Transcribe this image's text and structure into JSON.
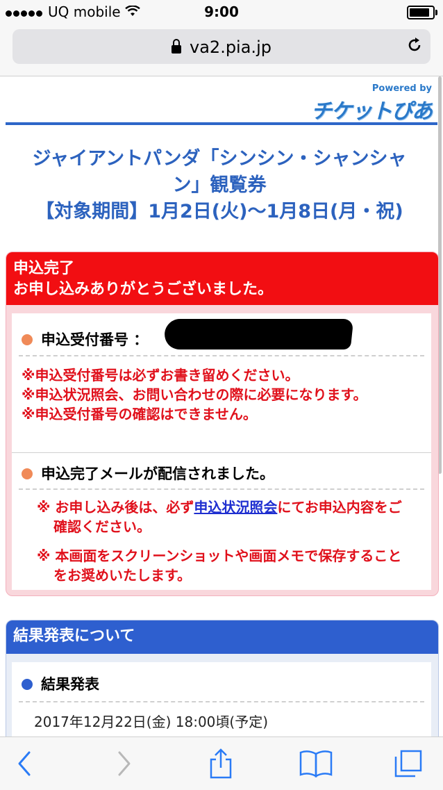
{
  "status_bar": {
    "carrier": "UQ mobile",
    "time": "9:00"
  },
  "browser": {
    "url": "va2.pia.jp"
  },
  "logo": {
    "powered_by": "Powered by",
    "brand": "チケットぴあ"
  },
  "event": {
    "title_line1": "ジャイアントパンダ「シンシン・シャンシャ",
    "title_line2": "ン」観覧券",
    "period": "【対象期間】1月2日(火)〜1月8日(月・祝)"
  },
  "complete": {
    "heading_line1": "申込完了",
    "heading_line2": "お申し込みありがとうございました。",
    "receipt_label": "申込受付番号 ：",
    "notes": [
      "※申込受付番号は必ずお書き留めください。",
      "※申込状況照会、お問い合わせの際に必要になります。",
      "※申込受付番号の確認はできません。"
    ],
    "mail_label": "申込完了メールが配信されました。",
    "mail_note1_prefix": "※ お申し込み後は、必ず",
    "mail_note1_link": "申込状況照会",
    "mail_note1_suffix": "にてお申込内容をご確認ください。",
    "mail_note2": "※ 本画面をスクリーンショットや画面メモで保存することをお奨めいたします。"
  },
  "result": {
    "heading": "結果発表について",
    "label": "結果発表",
    "date": "2017年12月22日(金) 18:00頃(予定)"
  }
}
